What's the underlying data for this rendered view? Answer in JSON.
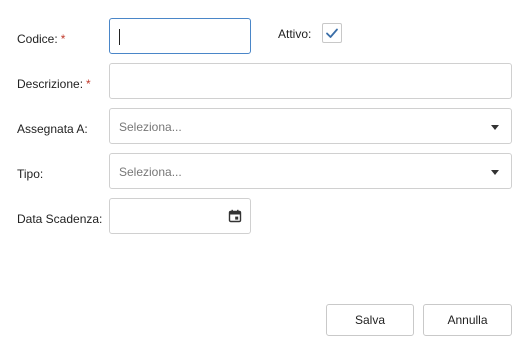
{
  "form": {
    "codice": {
      "label": "Codice:",
      "required_mark": "*",
      "value": ""
    },
    "attivo": {
      "label": "Attivo:",
      "checked": true
    },
    "descrizione": {
      "label": "Descrizione:",
      "required_mark": "*",
      "value": ""
    },
    "assegnata": {
      "label": "Assegnata A:",
      "placeholder": "Seleziona..."
    },
    "tipo": {
      "label": "Tipo:",
      "placeholder": "Seleziona..."
    },
    "data_scadenza": {
      "label": "Data Scadenza:",
      "value": ""
    }
  },
  "actions": {
    "save_label": "Salva",
    "cancel_label": "Annulla"
  },
  "colors": {
    "required": "#c0392b",
    "focus_border": "#4a86c8",
    "check": "#3a6ea8"
  },
  "icons": {
    "checkbox": "check-icon",
    "dropdown": "caret-down-icon",
    "date": "calendar-icon"
  }
}
